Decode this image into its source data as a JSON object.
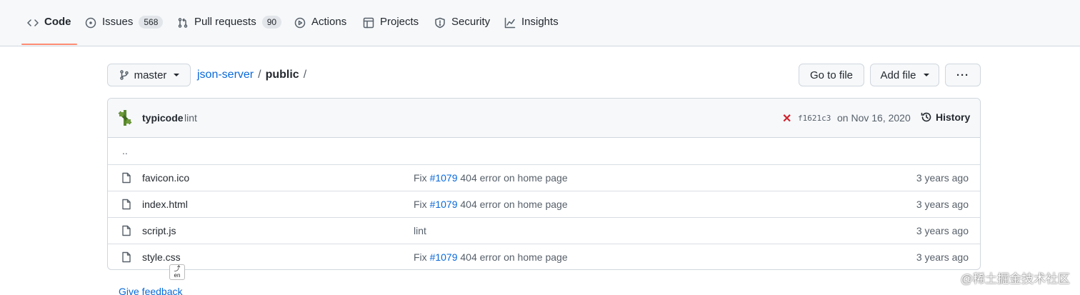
{
  "tabs": [
    {
      "label": "Code",
      "icon": "code-icon",
      "selected": true
    },
    {
      "label": "Issues",
      "icon": "issue-opened-icon",
      "count": "568"
    },
    {
      "label": "Pull requests",
      "icon": "git-pull-request-icon",
      "count": "90"
    },
    {
      "label": "Actions",
      "icon": "play-icon"
    },
    {
      "label": "Projects",
      "icon": "table-icon"
    },
    {
      "label": "Security",
      "icon": "shield-icon"
    },
    {
      "label": "Insights",
      "icon": "graph-icon"
    }
  ],
  "toolbar": {
    "branch": "master",
    "repo": "json-server",
    "separator": "/",
    "directory": "public",
    "trailing_separator": "/",
    "go_to_file": "Go to file",
    "add_file": "Add file",
    "more": "···"
  },
  "commit": {
    "author": "typicode",
    "message": "lint",
    "status": "✕",
    "status_color": "#cf222e",
    "sha": "f1621c3",
    "date": "on Nov 16, 2020",
    "history_label": "History"
  },
  "parent_dir": "..",
  "files": [
    {
      "name": "favicon.ico",
      "msg_prefix": "Fix ",
      "issue": "#1079",
      "msg_suffix": " 404 error on home page",
      "age": "3 years ago"
    },
    {
      "name": "index.html",
      "msg_prefix": "Fix ",
      "issue": "#1079",
      "msg_suffix": " 404 error on home page",
      "age": "3 years ago"
    },
    {
      "name": "script.js",
      "msg_prefix": "lint",
      "issue": "",
      "msg_suffix": "",
      "age": "3 years ago"
    },
    {
      "name": "style.css",
      "msg_prefix": "Fix ",
      "issue": "#1079",
      "msg_suffix": " 404 error on home page",
      "age": "3 years ago"
    }
  ],
  "feedback": "Give feedback",
  "translate_badge": "en",
  "watermark": "@稀土掘金技术社区",
  "colors": {
    "accent": "#0969da",
    "tab_underline": "#fd8c73",
    "error": "#cf222e"
  }
}
